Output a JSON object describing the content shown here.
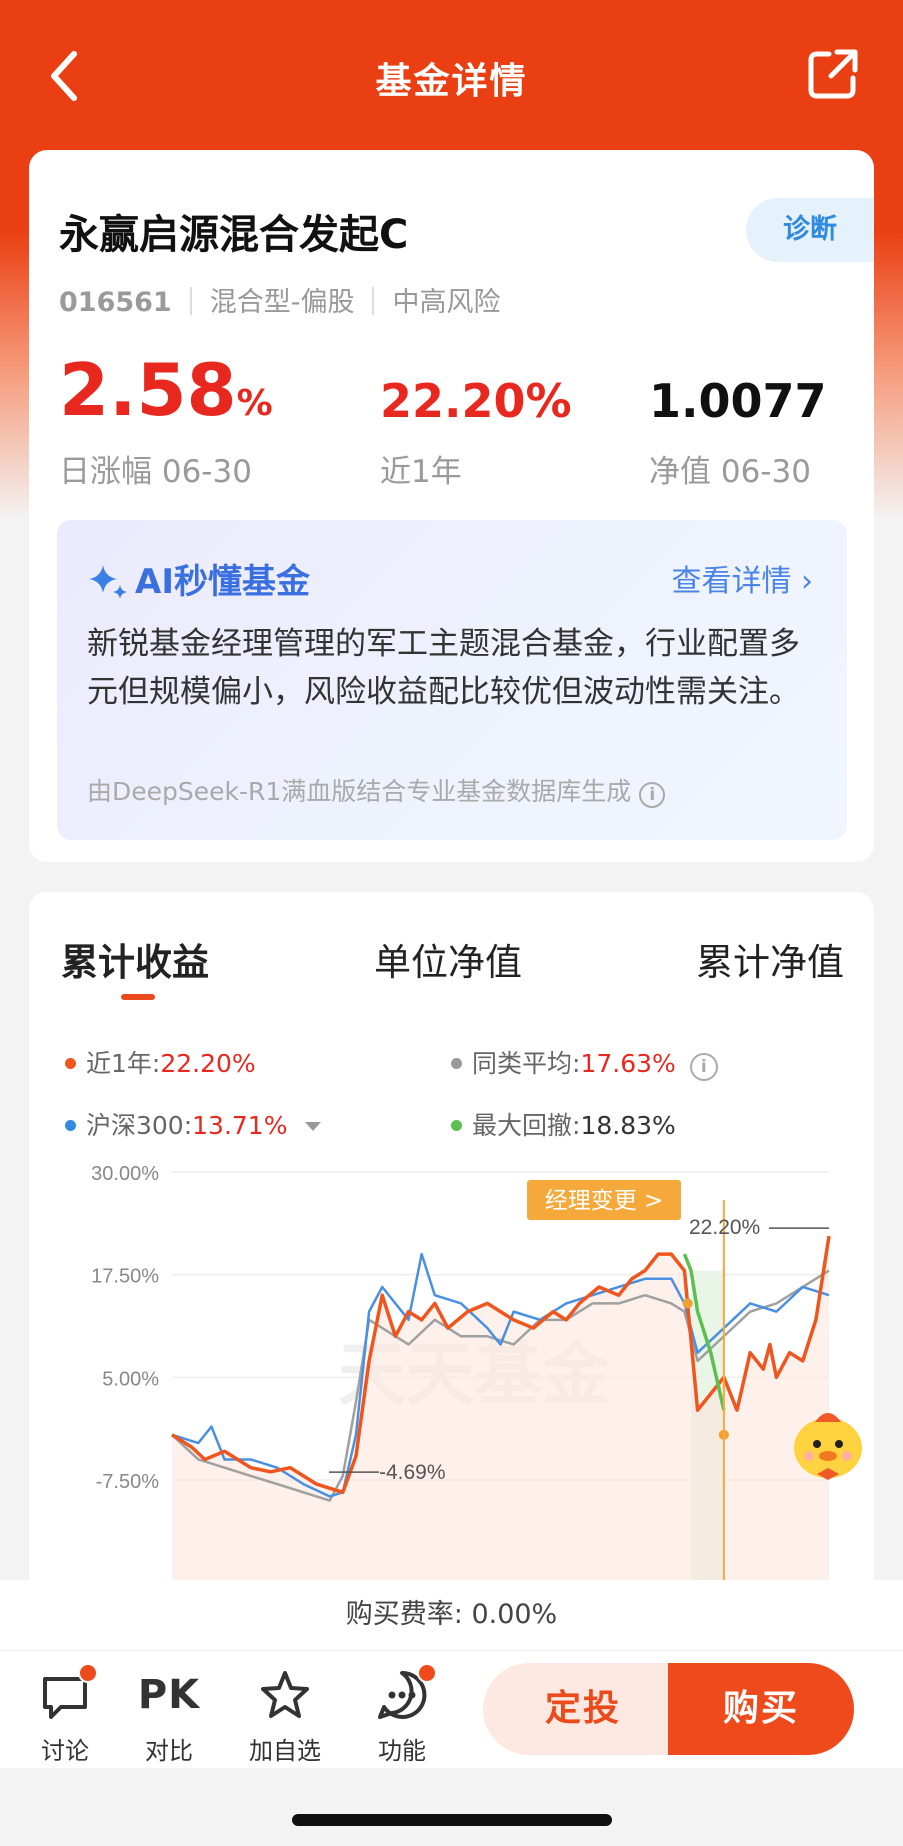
{
  "nav": {
    "title": "基金详情",
    "back_icon": "back-icon",
    "share_icon": "share-icon"
  },
  "fund": {
    "name": "永赢启源混合发起C",
    "code": "016561",
    "type": "混合型-偏股",
    "risk": "中高风险",
    "diagnose_label": "诊断"
  },
  "stats": {
    "daily_change_value": "2.58",
    "daily_change_unit": "%",
    "daily_change_label": "日涨幅 06-30",
    "year_return_value": "22.20%",
    "year_return_label": "近1年",
    "nav_value": "1.0077",
    "nav_label": "净值 06-30"
  },
  "ai": {
    "title": "AI秒懂基金",
    "more": "查看详情 ›",
    "text": "新锐基金经理管理的军工主题混合基金，行业配置多元但规模偏小，风险收益配比较优但波动性需关注。",
    "note": "由DeepSeek-R1满血版结合专业基金数据库生成"
  },
  "tabs": [
    "累计收益",
    "单位净值",
    "累计净值"
  ],
  "legend": {
    "l1_label": "近1年:",
    "l1_value": "22.20%",
    "l2_label": "同类平均:",
    "l2_value": "17.63%",
    "l3_label": "沪深300:",
    "l3_value": "13.71%",
    "l4_label": "最大回撤:",
    "l4_value": "18.83%"
  },
  "chart_data": {
    "type": "line",
    "y_ticks": [
      "30.00%",
      "17.50%",
      "5.00%",
      "-7.50%"
    ],
    "ylim": [
      -10,
      30
    ],
    "watermark": "天天基金",
    "annotations": {
      "manager_change": "经理变更 >",
      "max_label": "22.20%",
      "min_label": "-4.69%"
    },
    "colors": {
      "fund": "#f0551e",
      "category_avg": "#a0a0a0",
      "hs300": "#4a90e2",
      "drawdown": "#5cbf4f"
    },
    "series": [
      {
        "name": "近1年",
        "x": [
          0,
          3,
          5,
          8,
          10,
          12,
          15,
          18,
          20,
          22,
          24,
          26,
          28,
          30,
          32,
          34,
          36,
          38,
          40,
          42,
          45,
          48,
          50,
          52,
          55,
          58,
          60,
          62,
          65,
          68,
          70,
          72,
          74,
          76,
          78,
          80,
          82,
          84,
          86,
          88,
          90,
          91,
          92,
          94,
          96,
          98,
          100
        ],
        "values": [
          -2,
          -3.5,
          -5,
          -4,
          -5,
          -6,
          -6.5,
          -6,
          -7,
          -8,
          -8.5,
          -9,
          -4.6,
          7,
          15,
          10,
          13,
          12,
          14,
          11,
          13,
          14,
          13,
          12,
          11,
          13,
          12,
          14,
          16,
          15,
          17,
          18,
          20,
          20,
          18,
          1,
          3,
          5,
          1,
          8,
          6,
          9,
          5,
          8,
          7,
          12,
          22.2
        ]
      },
      {
        "name": "同类平均",
        "x": [
          0,
          4,
          8,
          12,
          16,
          20,
          24,
          26,
          28,
          30,
          32,
          36,
          40,
          44,
          48,
          52,
          56,
          60,
          64,
          68,
          72,
          76,
          78,
          80,
          84,
          88,
          92,
          96,
          100
        ],
        "values": [
          -2,
          -5,
          -6,
          -7,
          -8,
          -9,
          -10,
          -7,
          2,
          12,
          11,
          9,
          12,
          10,
          10,
          9,
          12,
          12,
          14,
          14,
          15,
          14,
          13,
          7,
          10,
          13,
          14,
          16,
          18
        ]
      },
      {
        "name": "沪深300",
        "x": [
          0,
          4,
          6,
          8,
          12,
          16,
          20,
          24,
          26,
          28,
          30,
          32,
          36,
          38,
          40,
          44,
          48,
          50,
          52,
          56,
          60,
          64,
          68,
          72,
          76,
          78,
          80,
          84,
          88,
          92,
          96,
          100
        ],
        "values": [
          -2,
          -3,
          -1,
          -5,
          -5,
          -6,
          -8,
          -9.5,
          -9,
          -2,
          13,
          16,
          12,
          20,
          15,
          14,
          11,
          9,
          13,
          12,
          14,
          15,
          16,
          17,
          17,
          14,
          8,
          11,
          14,
          13,
          16,
          15
        ]
      }
    ]
  },
  "fee": {
    "label": "购买费率: 0.00%"
  },
  "bottom": {
    "discuss": "讨论",
    "compare": "对比",
    "compare_icon_text": "PK",
    "watchlist": "加自选",
    "more": "功能",
    "dingtou": "定投",
    "buy": "购买"
  }
}
